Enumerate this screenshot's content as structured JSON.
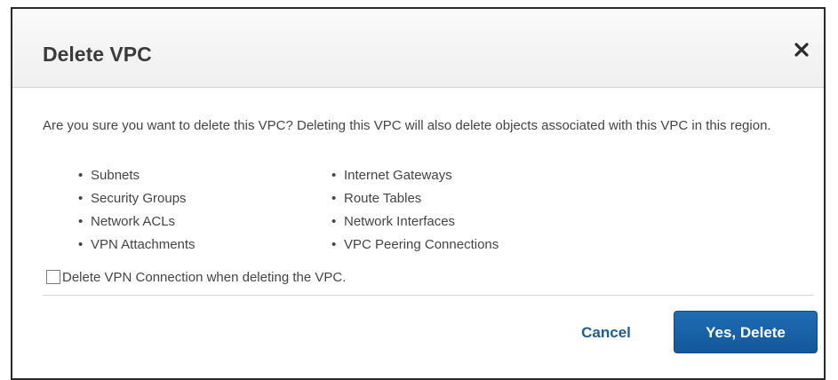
{
  "dialog": {
    "title": "Delete VPC",
    "close_icon": "close-icon",
    "message": "Are you sure you want to delete this VPC? Deleting this VPC will also delete objects associated with this VPC in this region.",
    "objects_left": [
      "Subnets",
      "Security Groups",
      "Network ACLs",
      "VPN Attachments"
    ],
    "objects_right": [
      "Internet Gateways",
      "Route Tables",
      "Network Interfaces",
      "VPC Peering Connections"
    ],
    "checkbox_label": "Delete VPN Connection when deleting the VPC.",
    "checkbox_checked": false,
    "cancel_label": "Cancel",
    "confirm_label": "Yes, Delete"
  },
  "colors": {
    "primary": "#1a66ad",
    "link": "#1a5d9e",
    "text": "#444444"
  }
}
